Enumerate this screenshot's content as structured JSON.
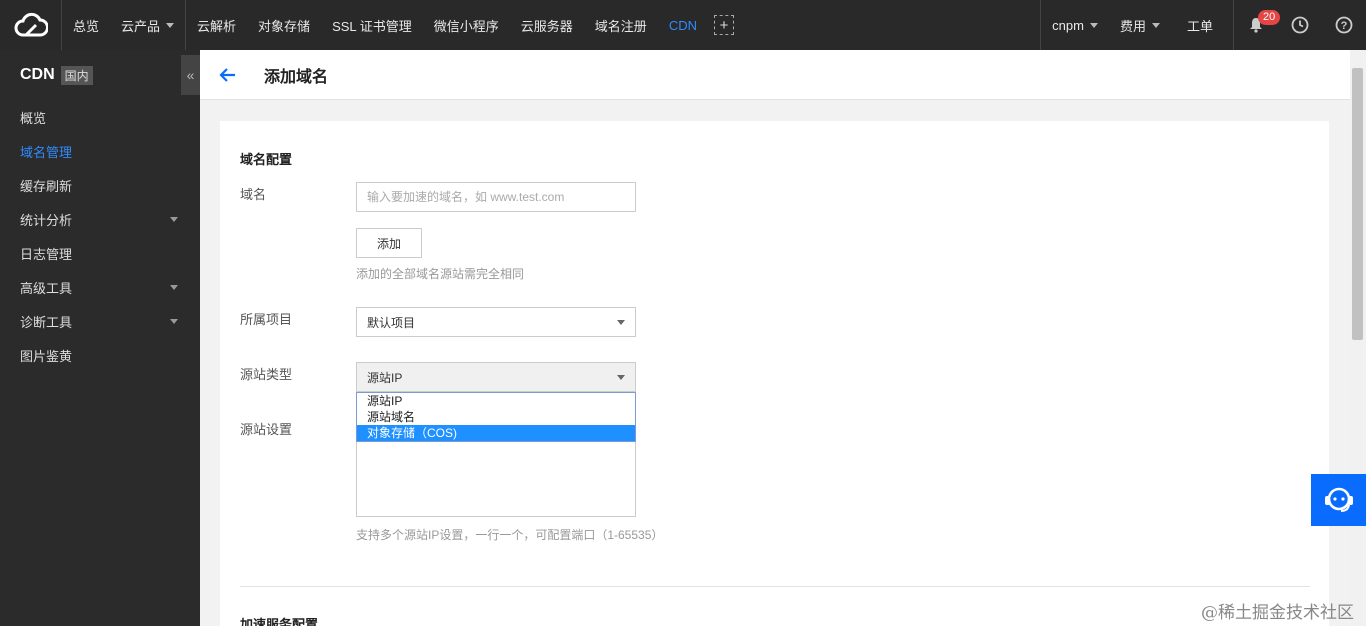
{
  "topbar": {
    "nav": [
      "总览",
      "云产品"
    ],
    "products": [
      "云解析",
      "对象存储",
      "SSL 证书管理",
      "微信小程序",
      "云服务器",
      "域名注册",
      "CDN"
    ],
    "account": "cnpm",
    "billing": "费用",
    "ticket": "工单",
    "notifications": "20"
  },
  "sidebar": {
    "title": "CDN",
    "region": "国内",
    "collapse": "«",
    "items": [
      {
        "label": "概览"
      },
      {
        "label": "域名管理"
      },
      {
        "label": "缓存刷新"
      },
      {
        "label": "统计分析"
      },
      {
        "label": "日志管理"
      },
      {
        "label": "高级工具"
      },
      {
        "label": "诊断工具"
      },
      {
        "label": "图片鉴黄"
      }
    ]
  },
  "page": {
    "title": "添加域名"
  },
  "form": {
    "section_title": "域名配置",
    "domain_label": "域名",
    "domain_placeholder": "输入要加速的域名，如 www.test.com",
    "add_button": "添加",
    "add_hint": "添加的全部域名源站需完全相同",
    "project_label": "所属项目",
    "project_value": "默认项目",
    "origin_type_label": "源站类型",
    "origin_type_value": "源站IP",
    "origin_type_options": [
      "源站IP",
      "源站域名",
      "对象存储（COS)"
    ],
    "origin_setting_label": "源站设置",
    "origin_hint": "支持多个源站IP设置，一行一个，可配置端口（1-65535）",
    "next_section_title": "加速服务配置"
  },
  "watermark": "@稀土掘金技术社区",
  "colors": {
    "accent": "#2f8bff",
    "topbar": "#292929",
    "sidebar": "#2b2b2b",
    "selected_option": "#1e90ff",
    "badge": "#e54545"
  }
}
